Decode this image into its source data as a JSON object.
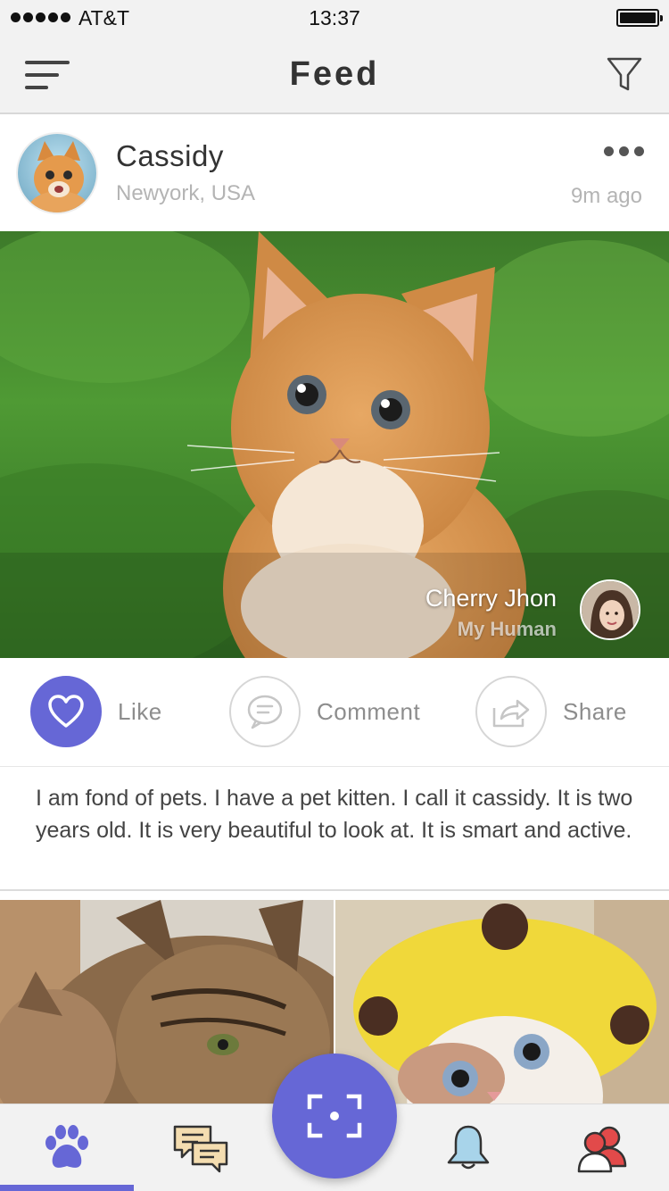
{
  "status_bar": {
    "carrier": "AT&T",
    "time": "13:37",
    "signal_dots": 5
  },
  "nav": {
    "title": "Feed",
    "menu_icon": "hamburger-icon",
    "filter_icon": "filter-icon"
  },
  "post": {
    "author": "Cassidy",
    "location": "Newyork, USA",
    "time_ago": "9m ago",
    "more_icon": "ellipsis-icon",
    "human": {
      "name": "Cherry Jhon",
      "role": "My Human"
    },
    "actions": {
      "like": {
        "label": "Like",
        "icon": "heart-icon",
        "active": true
      },
      "comment": {
        "label": "Comment",
        "icon": "chat-bubble-icon"
      },
      "share": {
        "label": "Share",
        "icon": "share-arrow-icon"
      }
    },
    "caption": "I am fond of pets. I have a pet kitten. I call it cassidy. It is two years old. It is very beautiful to look at. It is smart and active."
  },
  "tab_bar": {
    "items": [
      {
        "name": "paw",
        "icon": "paw-icon",
        "active": true
      },
      {
        "name": "messages",
        "icon": "chat-icon"
      },
      {
        "name": "scan",
        "icon": "scan-icon"
      },
      {
        "name": "notifications",
        "icon": "bell-icon"
      },
      {
        "name": "friends",
        "icon": "users-icon"
      }
    ]
  },
  "colors": {
    "accent": "#6667d6",
    "bar_background": "#f2f2f2",
    "muted_text": "#b4b4b4"
  }
}
